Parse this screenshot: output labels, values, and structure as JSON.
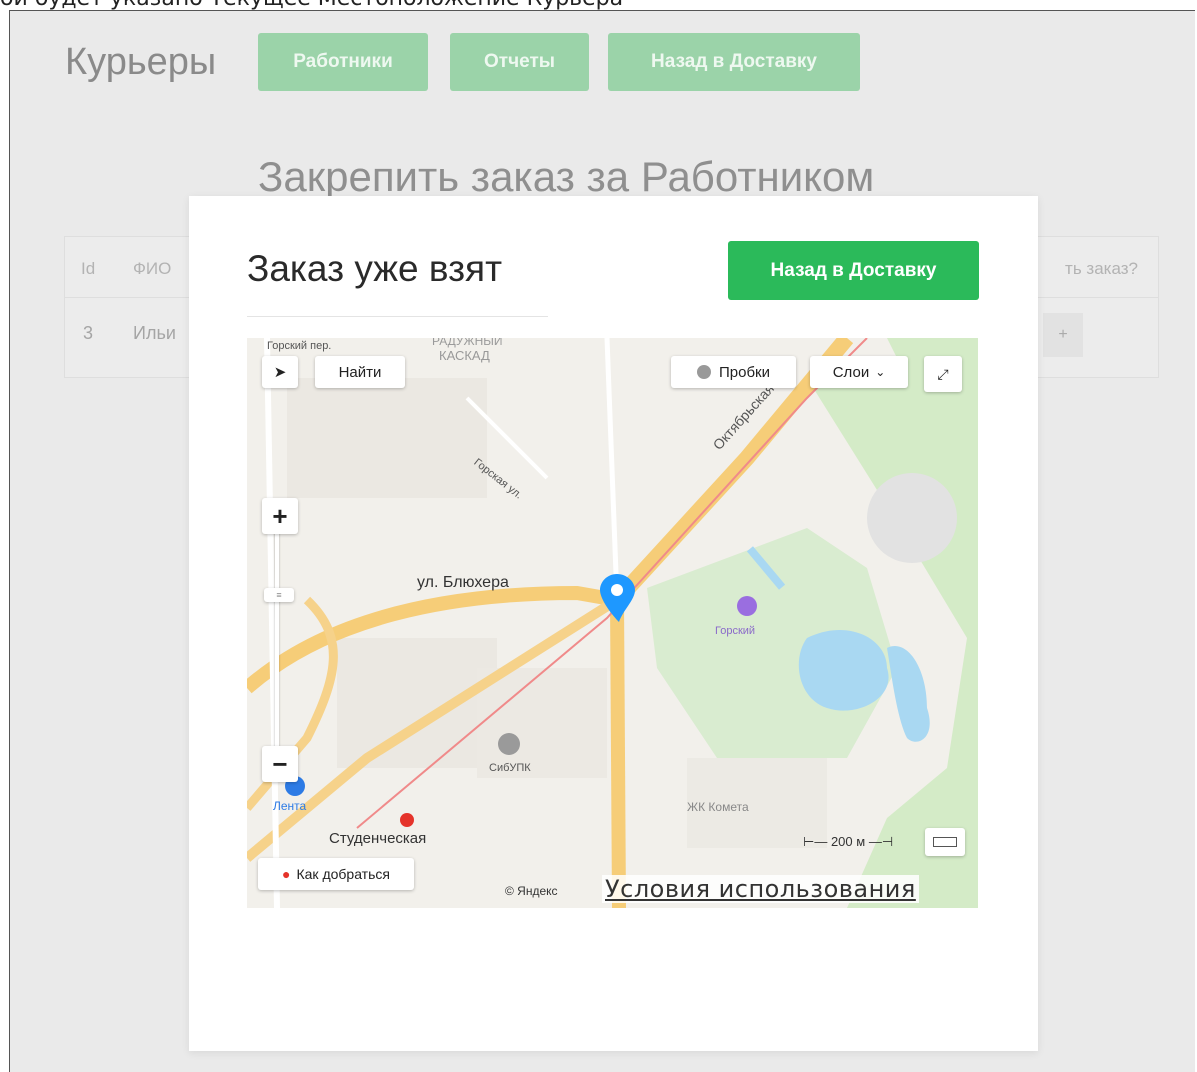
{
  "caption": "ой будет указано Текущее Местоположение Курьера",
  "background_page": {
    "brand": "Курьеры",
    "nav": [
      "Работники",
      "Отчеты",
      "Назад в Доставку"
    ],
    "heading": "Закрепить заказ за Работником",
    "table": {
      "headers": [
        "Id",
        "ФИО",
        "ть заказ?"
      ],
      "row": [
        "3",
        "Ильи",
        "+"
      ]
    }
  },
  "modal": {
    "title": "Заказ уже взят",
    "back_button": "Назад в Доставку"
  },
  "map": {
    "controls": {
      "find": "Найти",
      "traffic": "Пробки",
      "layers": "Слои",
      "zoom_in": "+",
      "zoom_out": "−",
      "route": "Как добраться",
      "scale": "200 м"
    },
    "labels": {
      "street_bluhera": "ул. Блюхера",
      "street_oktyabrskaya": "Октябрьская маг.",
      "street_gorskaya": "Горская ул.",
      "district": "КАСКАД",
      "district_top": "РАДУЖНЫЙ",
      "lane": "Горский пер.",
      "metro": "Студенческая",
      "shop": "Лента",
      "college": "СибУПК",
      "park": "Горский",
      "residential": "ЖК Комета"
    },
    "copyright": "© Яндекс",
    "terms": "Условия использования"
  },
  "colors": {
    "primary": "#2bba5a",
    "primary_dimmed": "#9bd3a9",
    "marker": "#1e98ff",
    "metro": "#e5332a",
    "road": "#f5cf7a",
    "park": "#d8ecce",
    "water": "#a9d8f2"
  }
}
